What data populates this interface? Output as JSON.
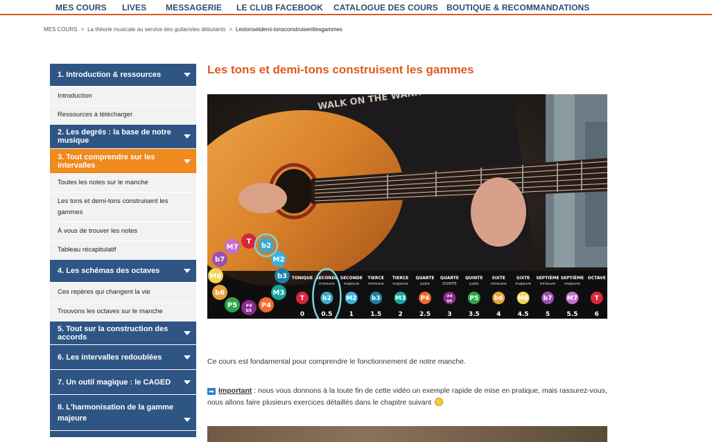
{
  "nav": {
    "items": [
      "MES COURS",
      "LIVES",
      "MESSAGERIE",
      "LE CLUB FACEBOOK",
      "CATALOGUE DES COURS",
      "BOUTIQUE & RECOMMANDATIONS"
    ]
  },
  "breadcrumb": {
    "items": [
      "MES COURS",
      "La théorie musicale au service des guitaristes débutants",
      "Lestonsetdemi-tonsconstruisentlesgammes"
    ],
    "separator": ">"
  },
  "sidebar": {
    "sections": [
      {
        "label": "1. Introduction & ressources",
        "lessons": [
          "Introduction",
          "Ressources à télécharger"
        ]
      },
      {
        "label": "2. Les degrés : la base de notre musique",
        "lessons": []
      },
      {
        "label": "3. Tout comprendre sur les intervalles",
        "active": true,
        "lessons": [
          "Toutes les notes sur le manche",
          "Les tons et demi-tons construisent les gammes",
          "À vous de trouver les notes",
          "Tableau récapitulatif"
        ]
      },
      {
        "label": "4. Les schémas des octaves",
        "lessons": [
          "Ces repères qui changent la vie",
          "Trouvons les octaves sur le manche"
        ]
      },
      {
        "label": "5. Tout sur la construction des accords",
        "lessons": []
      },
      {
        "label": "6. Les intervalles redoublées",
        "lessons": []
      },
      {
        "label": "7. Un outil magique : le CAGED",
        "lessons": []
      },
      {
        "label": "8. L'harmonisation de la gamme majeure",
        "lessons": []
      }
    ]
  },
  "main": {
    "title": "Les tons et demi-tons construisent les gammes",
    "intro": "Ce cours est fondamental pour comprendre le fonctionnement de notre manche.",
    "important_label": "Important",
    "important_colon": " :",
    "important_text": "  nous vous donnons à la toute fin de cette vidéo un exemple rapide de mise en pratique, mais rassurez-vous, nous allons faire plusieurs exercices détaillés dans le chapitre suivant"
  },
  "video": {
    "tshirt_text": "WALK ON THE WARR",
    "intervals": [
      {
        "name": "TONIQUE",
        "sub": "",
        "badge": "T",
        "color": "#d7263d",
        "value": "0"
      },
      {
        "name": "SECONDE",
        "sub": "mineure",
        "badge": "b2",
        "color": "#3aa9c9",
        "value": "0.5"
      },
      {
        "name": "SECONDE",
        "sub": "majeure",
        "badge": "M2",
        "color": "#3bb0e0",
        "value": "1"
      },
      {
        "name": "TIERCE",
        "sub": "mineure",
        "badge": "b3",
        "color": "#1e7fa6",
        "value": "1.5"
      },
      {
        "name": "TIERCE",
        "sub": "majeure",
        "badge": "M3",
        "color": "#16a39a",
        "value": "2"
      },
      {
        "name": "QUARTE",
        "sub": "juste",
        "badge": "P4",
        "color": "#f06a2a",
        "value": "2.5"
      },
      {
        "name": "QUARTE",
        "sub": "QUINTE",
        "badge": "#4 b5",
        "color": "#8b2c8e",
        "value": "3"
      },
      {
        "name": "QUINTE",
        "sub": "juste",
        "badge": "P5",
        "color": "#2ea34a",
        "value": "3.5"
      },
      {
        "name": "SIXTE",
        "sub": "mineure",
        "badge": "b6",
        "color": "#e8a23a",
        "value": "4"
      },
      {
        "name": "SIXTE",
        "sub": "majeure",
        "badge": "M6",
        "color": "#f1d35a",
        "value": "4.5"
      },
      {
        "name": "SEPTIÈME",
        "sub": "mineure",
        "badge": "b7",
        "color": "#9a4fb0",
        "value": "5"
      },
      {
        "name": "SEPTIÈME",
        "sub": "majeure",
        "badge": "M7",
        "color": "#c66fcf",
        "value": "5.5"
      },
      {
        "name": "OCTAVE",
        "sub": "",
        "badge": "T",
        "color": "#d7263d",
        "value": "6"
      }
    ],
    "wheel": [
      {
        "badge": "M7",
        "color": "#c66fcf"
      },
      {
        "badge": "T",
        "color": "#d7263d"
      },
      {
        "badge": "b2",
        "color": "#3aa9c9"
      },
      {
        "badge": "b7",
        "color": "#9a4fb0"
      },
      {
        "badge": "M2",
        "color": "#3bb0e0"
      },
      {
        "badge": "M6",
        "color": "#f1d35a"
      },
      {
        "badge": "b3",
        "color": "#1e7fa6"
      },
      {
        "badge": "b6",
        "color": "#e8a23a"
      },
      {
        "badge": "M3",
        "color": "#16a39a"
      },
      {
        "badge": "P5",
        "color": "#2ea34a"
      },
      {
        "badge": "#4 b5",
        "color": "#8b2c8e"
      },
      {
        "badge": "P4",
        "color": "#f06a2a"
      }
    ]
  }
}
